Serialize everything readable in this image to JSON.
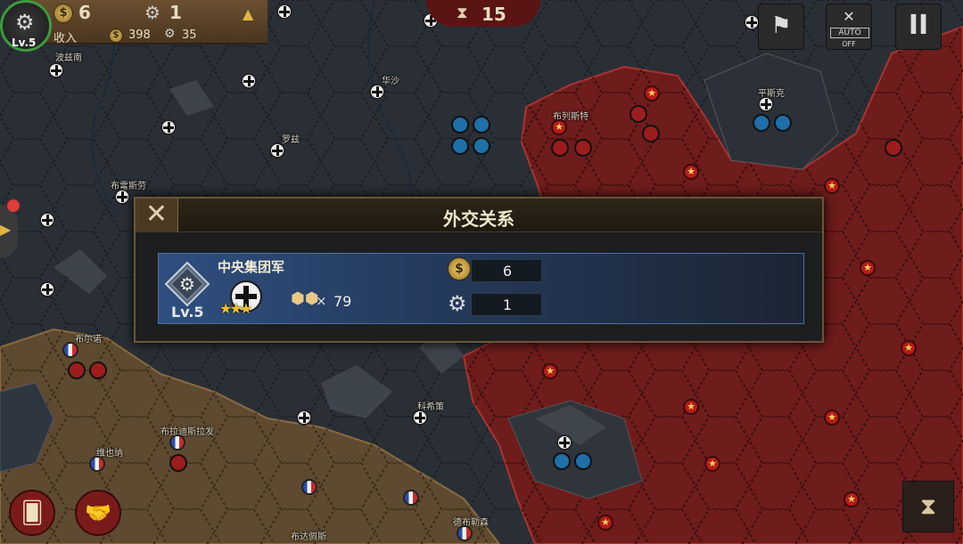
{
  "hud": {
    "level": "Lv.5",
    "gold": "6",
    "industry": "1",
    "income_label": "收入",
    "income_gold": "398",
    "income_industry": "35"
  },
  "turn": {
    "value": "15"
  },
  "top_buttons": {
    "auto_label": "AUTO",
    "auto_state": "OFF"
  },
  "map_cities": [
    {
      "label": "波兹南"
    },
    {
      "label": "华沙"
    },
    {
      "label": "罗兹"
    },
    {
      "label": "布列斯特"
    },
    {
      "label": "平斯克"
    },
    {
      "label": "布雷斯劳"
    },
    {
      "label": "布尔诺"
    },
    {
      "label": "布拉迪斯拉发"
    },
    {
      "label": "维也纳"
    },
    {
      "label": "科希策"
    },
    {
      "label": "德布勒森"
    },
    {
      "label": "布达佩斯"
    }
  ],
  "dialog": {
    "title": "外交关系",
    "row": {
      "name": "中央集团军",
      "level": "Lv.5",
      "stars": "★★★",
      "times": "×",
      "count": "79",
      "gold": "6",
      "industry": "1"
    }
  },
  "colors": {
    "axis_territory": "#2a2f36",
    "soviet_territory": "#6e1c1c",
    "allied_territory": "#5e4a30",
    "dialog_border": "#6b5636",
    "row_highlight": "#2f4f80"
  },
  "icons": {
    "close": "close-icon",
    "gear": "gear-icon",
    "coin": "coin-icon",
    "hourglass": "hourglass-icon",
    "handshake": "handshake-icon",
    "cards": "cards-icon",
    "pause": "pause-icon",
    "flags": "flags-icon"
  }
}
